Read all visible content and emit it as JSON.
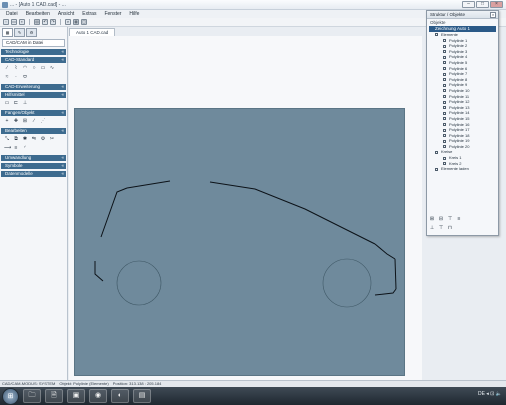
{
  "window": {
    "title": "... - [Auto 1 CAD.cad] - ...",
    "minimize": "–",
    "maximize": "□",
    "close": "×"
  },
  "menu": [
    "Datei",
    "Bearbeiten",
    "Ansicht",
    "Extras",
    "Fenster",
    "Hilfe"
  ],
  "toolbar_icons": [
    "new-icon",
    "open-icon",
    "save-icon",
    "print-icon",
    "undo-icon",
    "redo-icon",
    "zoom-icon",
    "grid-icon",
    "layer-icon"
  ],
  "sidebar": {
    "tabs": [
      "▦",
      "✎",
      "⚙"
    ],
    "subheader": "CAD/CAM in Datei",
    "sections": [
      {
        "label": "Technologie",
        "icons": []
      },
      {
        "label": "CAD-Standard",
        "icons": [
          "line-icon",
          "polyline-icon",
          "arc-icon",
          "circle-icon",
          "rect-icon",
          "curve-icon",
          "spline-icon",
          "point-icon",
          "ellipse-icon"
        ]
      },
      {
        "label": "CAD-Erweiterung",
        "icons": []
      },
      {
        "label": "Hilfsmittel",
        "icons": [
          "measure-icon",
          "text-icon",
          "dim-icon"
        ]
      },
      {
        "label": "Fangen/Objekt",
        "icons": [
          "snap-icon",
          "grid-snap-icon",
          "ortho-icon",
          "endpoint-icon",
          "midpoint-icon"
        ]
      },
      {
        "label": "Bearbeiten",
        "icons": [
          "move-icon",
          "copy-icon",
          "rotate-icon",
          "mirror-icon",
          "scale-icon",
          "trim-icon",
          "extend-icon",
          "offset-icon",
          "fillet-icon"
        ]
      },
      {
        "label": "Umwandlung",
        "icons": []
      },
      {
        "label": "Symbole",
        "icons": []
      },
      {
        "label": "Datenmodelle",
        "icons": []
      }
    ]
  },
  "document_tab": "Auto 1 CAD.cad",
  "panel": {
    "title": "Struktur / Objekte",
    "subtitle": "Objekte",
    "selected": "Zeichnung Auto 1",
    "group": "Elemente",
    "items": [
      "Polylinie 1",
      "Polylinie 2",
      "Polylinie 3",
      "Polylinie 4",
      "Polylinie 5",
      "Polylinie 6",
      "Polylinie 7",
      "Polylinie 8",
      "Polylinie 9",
      "Polylinie 10",
      "Polylinie 11",
      "Polylinie 12",
      "Polylinie 13",
      "Polylinie 14",
      "Polylinie 15",
      "Polylinie 16",
      "Polylinie 17",
      "Polylinie 18",
      "Polylinie 19",
      "Polylinie 20"
    ],
    "group2": "Kreise",
    "items2": [
      "Kreis 1",
      "Kreis 2"
    ],
    "footer_item": "Elemente laden"
  },
  "statusbar": {
    "left": "CAD/CAM-MODUS: SYSTEM",
    "mid": "Objekt: Polylinie (Elemente)",
    "right": "Position: 313.138 : 205.184"
  },
  "taskbar": {
    "start": "⊞",
    "apps": [
      "🗀",
      "🗎",
      "▣",
      "◉",
      "◐",
      "▤"
    ],
    "tray": "DE  ◂  ⊡  🔈"
  },
  "colors": {
    "accent": "#3d6b8f",
    "canvas": "#6f8a9c",
    "selection": "#2b5a88"
  }
}
